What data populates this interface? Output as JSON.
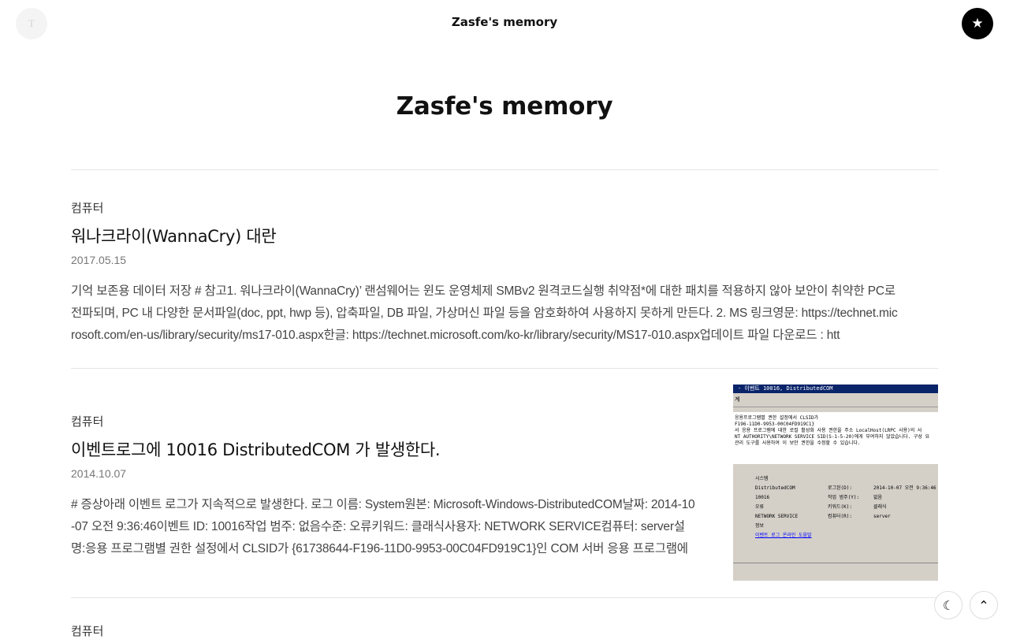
{
  "header": {
    "logo_letter": "T",
    "title": "Zasfe's memory"
  },
  "hero": {
    "title": "Zasfe's memory"
  },
  "posts": [
    {
      "category": "컴퓨터",
      "title": "워나크라이(WannaCry) 대란",
      "date": "2017.05.15",
      "excerpt": "기억 보존용 데이터 저장 # 참고1. 워나크라이(WannaCry)’ 랜섬웨어는 윈도 운영체제 SMBv2 원격코드실행 취약점*에 대한 패치를 적용하지 않아 보안이 취약한 PC로 전파되며, PC 내 다양한 문서파일(doc, ppt, hwp 등), 압축파일, DB 파일, 가상머신 파일 등을 암호화하여 사용하지 못하게 만든다. 2. MS 링크영문: https://technet.microsoft.com/en-us/library/security/ms17-010.aspx한글: https://technet.microsoft.com/ko-kr/library/security/MS17-010.aspx업데이트 파일 다운로드 : htt"
    },
    {
      "category": "컴퓨터",
      "title": "이벤트로그에 10016 DistributedCOM 가 발생한다.",
      "date": "2014.10.07",
      "excerpt": "# 증상아래 이벤트 로그가 지속적으로 발생한다. 로그 이름: System원본: Microsoft-Windows-DistributedCOM날짜: 2014-10-07 오전 9:36:46이벤트 ID: 10016작업 범주: 없음수준: 오류키워드: 클래식사용자: NETWORK SERVICE컴퓨터: server설명:응용 프로그램별 권한 설정에서 CLSID가 {61738644-F196-11D0-9953-00C04FD919C1}인 COM 서버 응용 프로그램에",
      "thumbnail": {
        "window_title": "- 이벤트 10016, DistributedCOM",
        "menu": "계",
        "info_lines": [
          "응용프로그램별 권한 설정에서 CLSID가",
          "F196-11D0-9953-00C04FD919C1}",
          "서 응용 프로그램에 대한 로컬 활성화 사용 권한을 주소 LocalHost(LRPC 사용)의 사",
          "NT AUTHORITY\\NETWORK SERVICE SID(S-1-5-20)에게 부여하지 않았습니다. 구성 요",
          "관리 도구를 사용하여 이 보안 권한을 수정할 수 있습니다."
        ],
        "fields": {
          "log_label": "시스템",
          "source": "DistributedCOM",
          "log_time_label": "로그된(D):",
          "log_time": "2014-10-07 오전 9:36:46",
          "event_id": "10016",
          "category_label": "작업 범주(Y):",
          "category": "없음",
          "level": "오류",
          "keyword_label": "키워드(K):",
          "keyword": "클래식",
          "user": "NETWORK SERVICE",
          "computer_label": "컴퓨터(R):",
          "computer": "server",
          "info_label": "정보",
          "link": "이벤트 로그 온라인 도움말"
        }
      }
    }
  ],
  "next_post": {
    "category": "컴퓨터"
  },
  "controls": {
    "star_icon": "★",
    "theme_icon": "☾",
    "top_icon": "⌃"
  }
}
